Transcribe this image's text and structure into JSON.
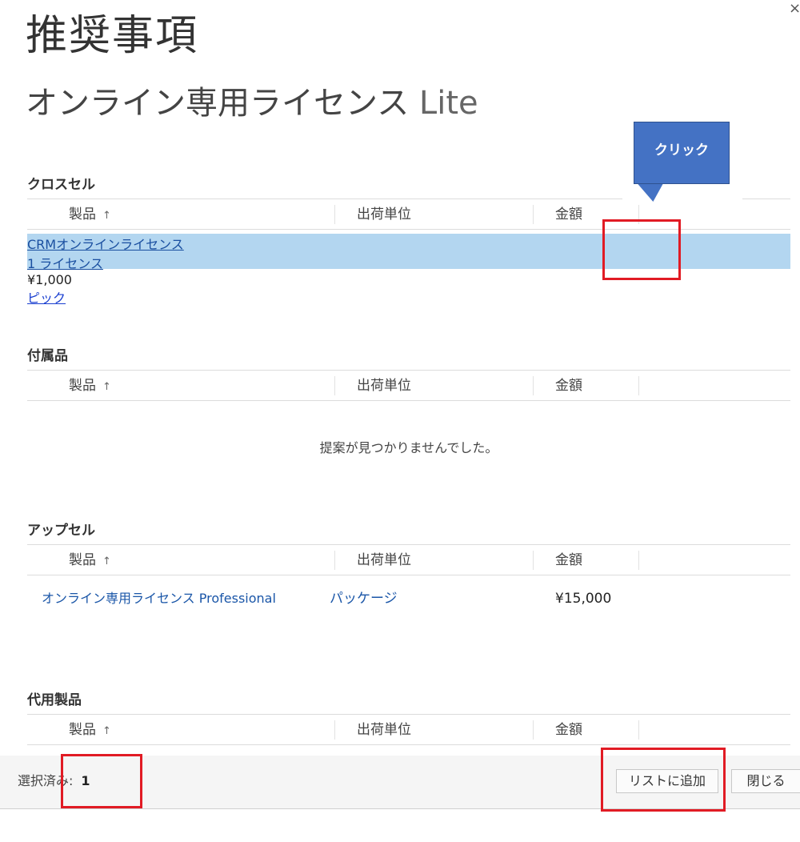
{
  "page": {
    "title": "推奨事項",
    "close_glyph": "×"
  },
  "product": {
    "name": "オンライン専用ライセンス",
    "edition": "Lite"
  },
  "columns": {
    "product": "製品",
    "sort_glyph": "↑",
    "unit": "出荷単位",
    "amount": "金額"
  },
  "cross_sell": {
    "title": "クロスセル",
    "row": {
      "product": "CRMオンラインライセンス",
      "unit": "1 ライセンス",
      "amount": "¥1,000",
      "action": "ピック",
      "selected": true
    }
  },
  "accessories": {
    "title": "付属品",
    "empty_message": "提案が見つかりませんでした。"
  },
  "upsell": {
    "title": "アップセル",
    "row": {
      "product": "オンライン専用ライセンス Professional",
      "unit": "パッケージ",
      "amount": "¥15,000"
    }
  },
  "substitutes": {
    "title": "代用製品"
  },
  "footer": {
    "selected_label": "選択済み:",
    "selected_count": "1",
    "add_button": "リストに追加",
    "close_button": "閉じる"
  },
  "annotation": {
    "callout_text": "クリック",
    "callout_color": "#4472c4",
    "highlight_color": "#e11b24"
  },
  "colors": {
    "selected_row": "#b3d6f0",
    "link": "#1a56a8"
  }
}
